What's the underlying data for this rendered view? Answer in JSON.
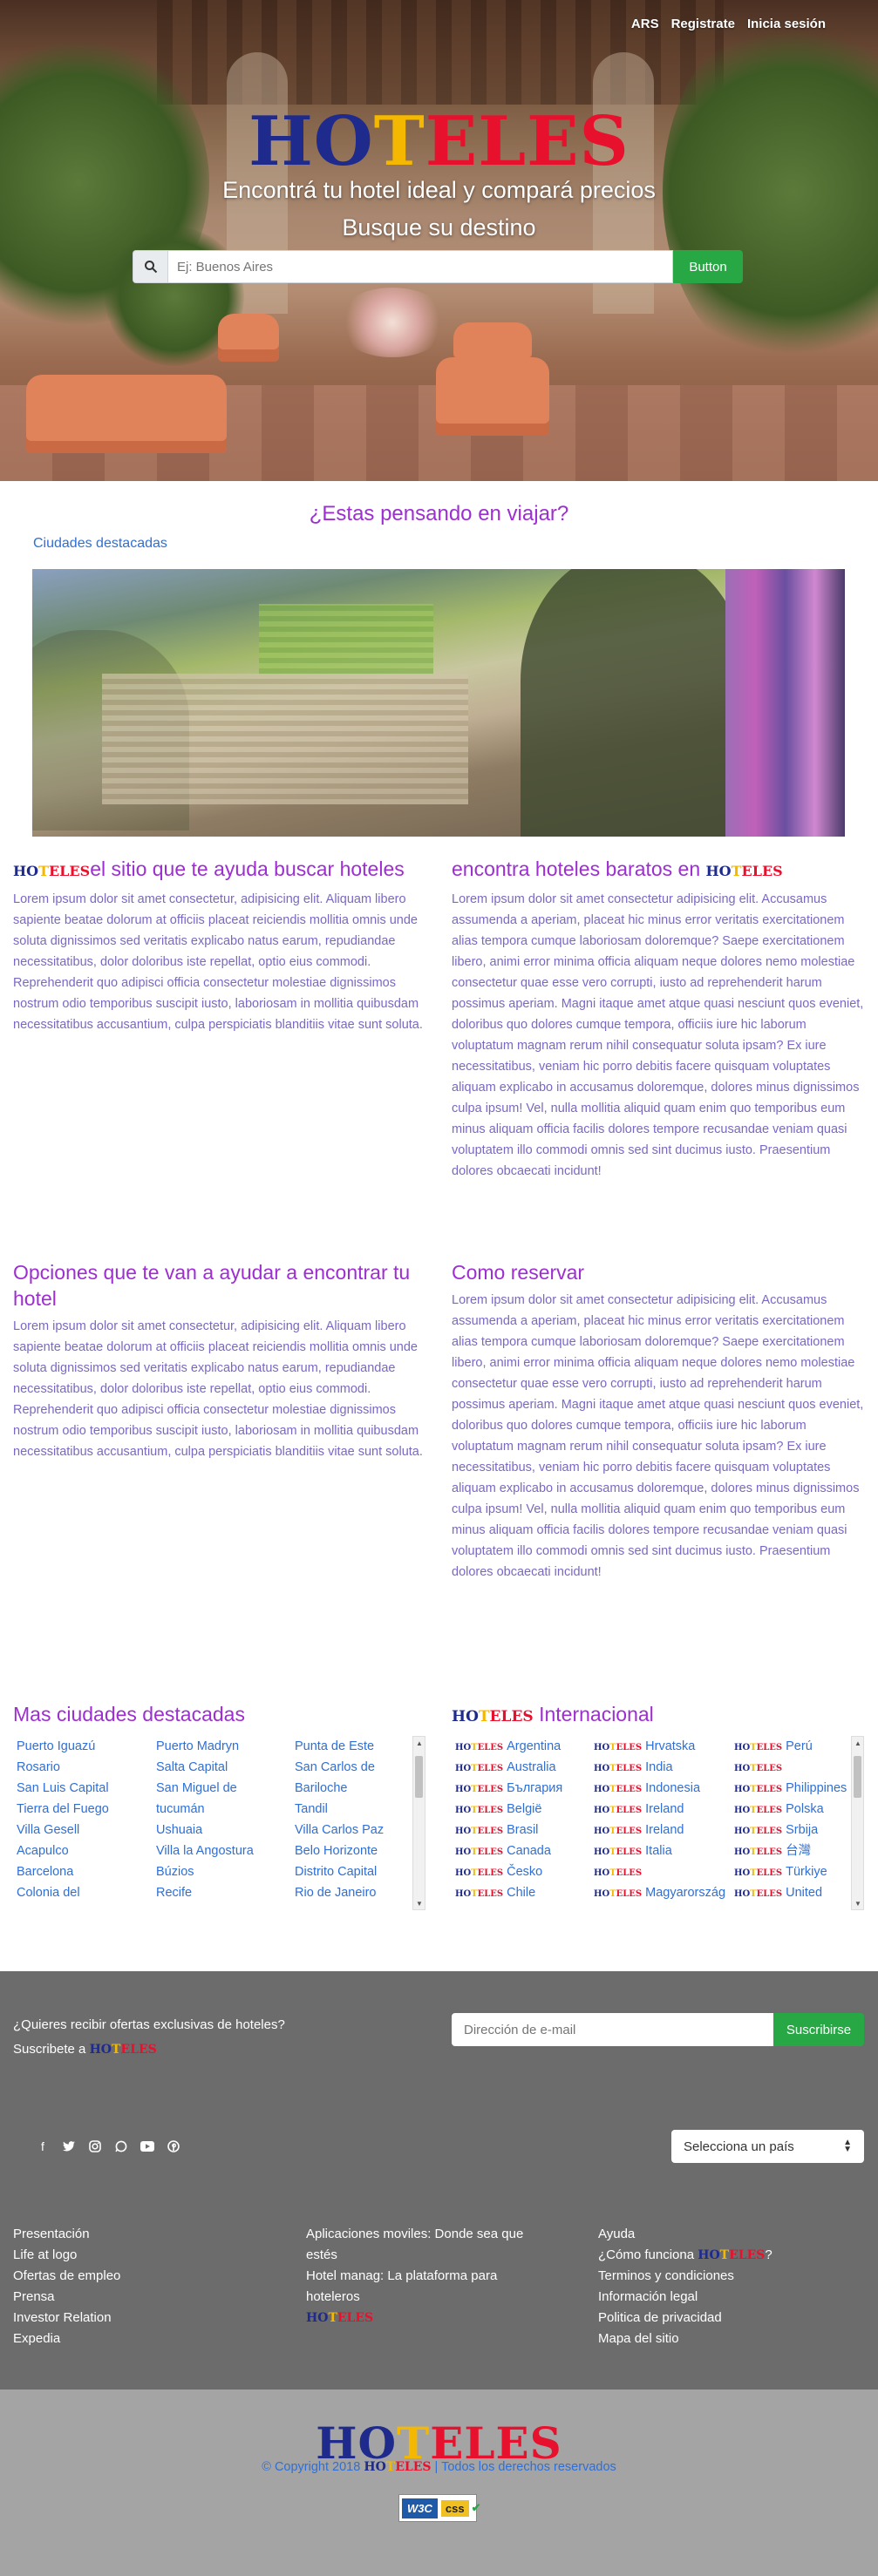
{
  "nav": {
    "currency": "ARS",
    "register": "Registrate",
    "login": "Inicia sesión"
  },
  "logo": {
    "h": "H",
    "o": "O",
    "t": "T",
    "e": "E",
    "l": "L",
    "e2": "E",
    "s": "S"
  },
  "hero": {
    "tagline": "Encontrá tu hotel ideal y compará precios",
    "subtitle": "Busque su destino",
    "search_placeholder": "Ej: Buenos Aires",
    "search_button": "Button",
    "search_icon": "search-icon"
  },
  "featured": {
    "title": "¿Estas pensando en viajar?",
    "subtitle": "Ciudades destacadas"
  },
  "blocks": {
    "b1_title": "el sitio que te ayuda buscar hoteles",
    "b1_text": "Lorem ipsum dolor sit amet consectetur, adipisicing elit. Aliquam libero sapiente beatae dolorum at officiis placeat reiciendis mollitia omnis unde soluta dignissimos sed veritatis explicabo natus earum, repudiandae necessitatibus, dolor doloribus iste repellat, optio eius commodi. Reprehenderit quo adipisci officia consectetur molestiae dignissimos nostrum odio temporibus suscipit iusto, laboriosam in mollitia quibusdam necessitatibus accusantium, culpa perspiciatis blanditiis vitae sunt soluta.",
    "b2_title": "encontra hoteles baratos en",
    "b2_text": "Lorem ipsum dolor sit amet consectetur adipisicing elit. Accusamus assumenda a aperiam, placeat hic minus error veritatis exercitationem alias tempora cumque laboriosam doloremque? Saepe exercitationem libero, animi error minima officia aliquam neque dolores nemo molestiae consectetur quae esse vero corrupti, iusto ad reprehenderit harum possimus aperiam. Magni itaque amet atque quasi nesciunt quos eveniet, doloribus quo dolores cumque tempora, officiis iure hic laborum voluptatum magnam rerum nihil consequatur soluta ipsam? Ex iure necessitatibus, veniam hic porro debitis facere quisquam voluptates aliquam explicabo in accusamus doloremque, dolores minus dignissimos culpa ipsum! Vel, nulla mollitia aliquid quam enim quo temporibus eum minus aliquam officia facilis dolores tempore recusandae veniam quasi voluptatem illo commodi omnis sed sint ducimus iusto. Praesentium dolores obcaecati incidunt!",
    "b3_title": "Opciones que te van a ayudar a encontrar tu hotel",
    "b3_text": "Lorem ipsum dolor sit amet consectetur, adipisicing elit. Aliquam libero sapiente beatae dolorum at officiis placeat reiciendis mollitia omnis unde soluta dignissimos sed veritatis explicabo natus earum, repudiandae necessitatibus, dolor doloribus iste repellat, optio eius commodi. Reprehenderit quo adipisci officia consectetur molestiae dignissimos nostrum odio temporibus suscipit iusto, laboriosam in mollitia quibusdam necessitatibus accusantium, culpa perspiciatis blanditiis vitae sunt soluta.",
    "b4_title": "Como reservar",
    "b4_text": "Lorem ipsum dolor sit amet consectetur adipisicing elit. Accusamus assumenda a aperiam, placeat hic minus error veritatis exercitationem alias tempora cumque laboriosam doloremque? Saepe exercitationem libero, animi error minima officia aliquam neque dolores nemo molestiae consectetur quae esse vero corrupti, iusto ad reprehenderit harum possimus aperiam. Magni itaque amet atque quasi nesciunt quos eveniet, doloribus quo dolores cumque tempora, officiis iure hic laborum voluptatum magnam rerum nihil consequatur soluta ipsam? Ex iure necessitatibus, veniam hic porro debitis facere quisquam voluptates aliquam explicabo in accusamus doloremque, dolores minus dignissimos culpa ipsum! Vel, nulla mollitia aliquid quam enim quo temporibus eum minus aliquam officia facilis dolores tempore recusandae veniam quasi voluptatem illo commodi omnis sed sint ducimus iusto. Praesentium dolores obcaecati incidunt!"
  },
  "cities": {
    "title": "Mas ciudades destacadas",
    "col1": [
      "Puerto Iguazú",
      "Rosario",
      "San Luis Capital",
      "Tierra del Fuego",
      "Villa Gesell",
      "Acapulco",
      "Barcelona",
      "Colonia del"
    ],
    "col2": [
      "Puerto Madryn",
      "Salta Capital",
      "San Miguel de",
      "tucumán",
      "Ushuaia",
      "Villa la Angostura",
      "Búzios",
      "Recife"
    ],
    "col3": [
      "Punta de Este",
      "San Carlos de",
      "Bariloche",
      "Tandil",
      "Villa Carlos Paz",
      "Belo Horizonte",
      "Distrito Capital",
      "Rio de Janeiro"
    ]
  },
  "international": {
    "title": "Internacional",
    "col1": [
      "Argentina",
      "Australia",
      "България",
      "België",
      "Brasil",
      "Canada",
      "Česko",
      "Chile"
    ],
    "col2": [
      "Hrvatska",
      "India",
      "Indonesia",
      "Ireland",
      "Ireland",
      "Italia",
      "",
      "Magyarország"
    ],
    "col3": [
      "Perú",
      "",
      "Philippines",
      "Polska",
      "Srbija",
      "台灣",
      "Türkiye",
      "United"
    ]
  },
  "newsletter": {
    "question": "¿Quieres recibir ofertas exclusivas de hoteles?",
    "subscribe_prefix": "Suscribete a",
    "email_placeholder": "Dirección de e-mail",
    "button": "Suscribirse"
  },
  "social_icons": [
    "facebook-icon",
    "twitter-icon",
    "instagram-icon",
    "whatsapp-icon",
    "youtube-icon",
    "pinterest-icon"
  ],
  "country_select": "Selecciona un país",
  "footer": {
    "col1": [
      "Presentación",
      "Life at logo",
      "Ofertas de empleo",
      "Prensa",
      "Investor Relation",
      "Expedia"
    ],
    "col2_1": "Aplicaciones moviles: Donde sea que",
    "col2_2": "estés",
    "col2_3": "Hotel manag: La plataforma para",
    "col2_4": "hoteleros",
    "col3_1": "Ayuda",
    "col3_2": "¿Cómo funciona",
    "col3_3": "Terminos y condiciones",
    "col3_4": "Información legal",
    "col3_5": "Politica de privacidad",
    "col3_6": "Mapa del sitio"
  },
  "copyright": {
    "prefix": "© Copyright 2018",
    "suffix": "| Todos los derechos reservados"
  },
  "w3c": {
    "w": "W3C",
    "css": "css"
  },
  "colors": {
    "purple": "#9d2fd1",
    "text": "#7b68c4",
    "link": "#2f6fd6",
    "green": "#28a745",
    "logo_blue": "#1e2a8c",
    "logo_yellow": "#f5b800",
    "logo_red": "#e8112d"
  }
}
